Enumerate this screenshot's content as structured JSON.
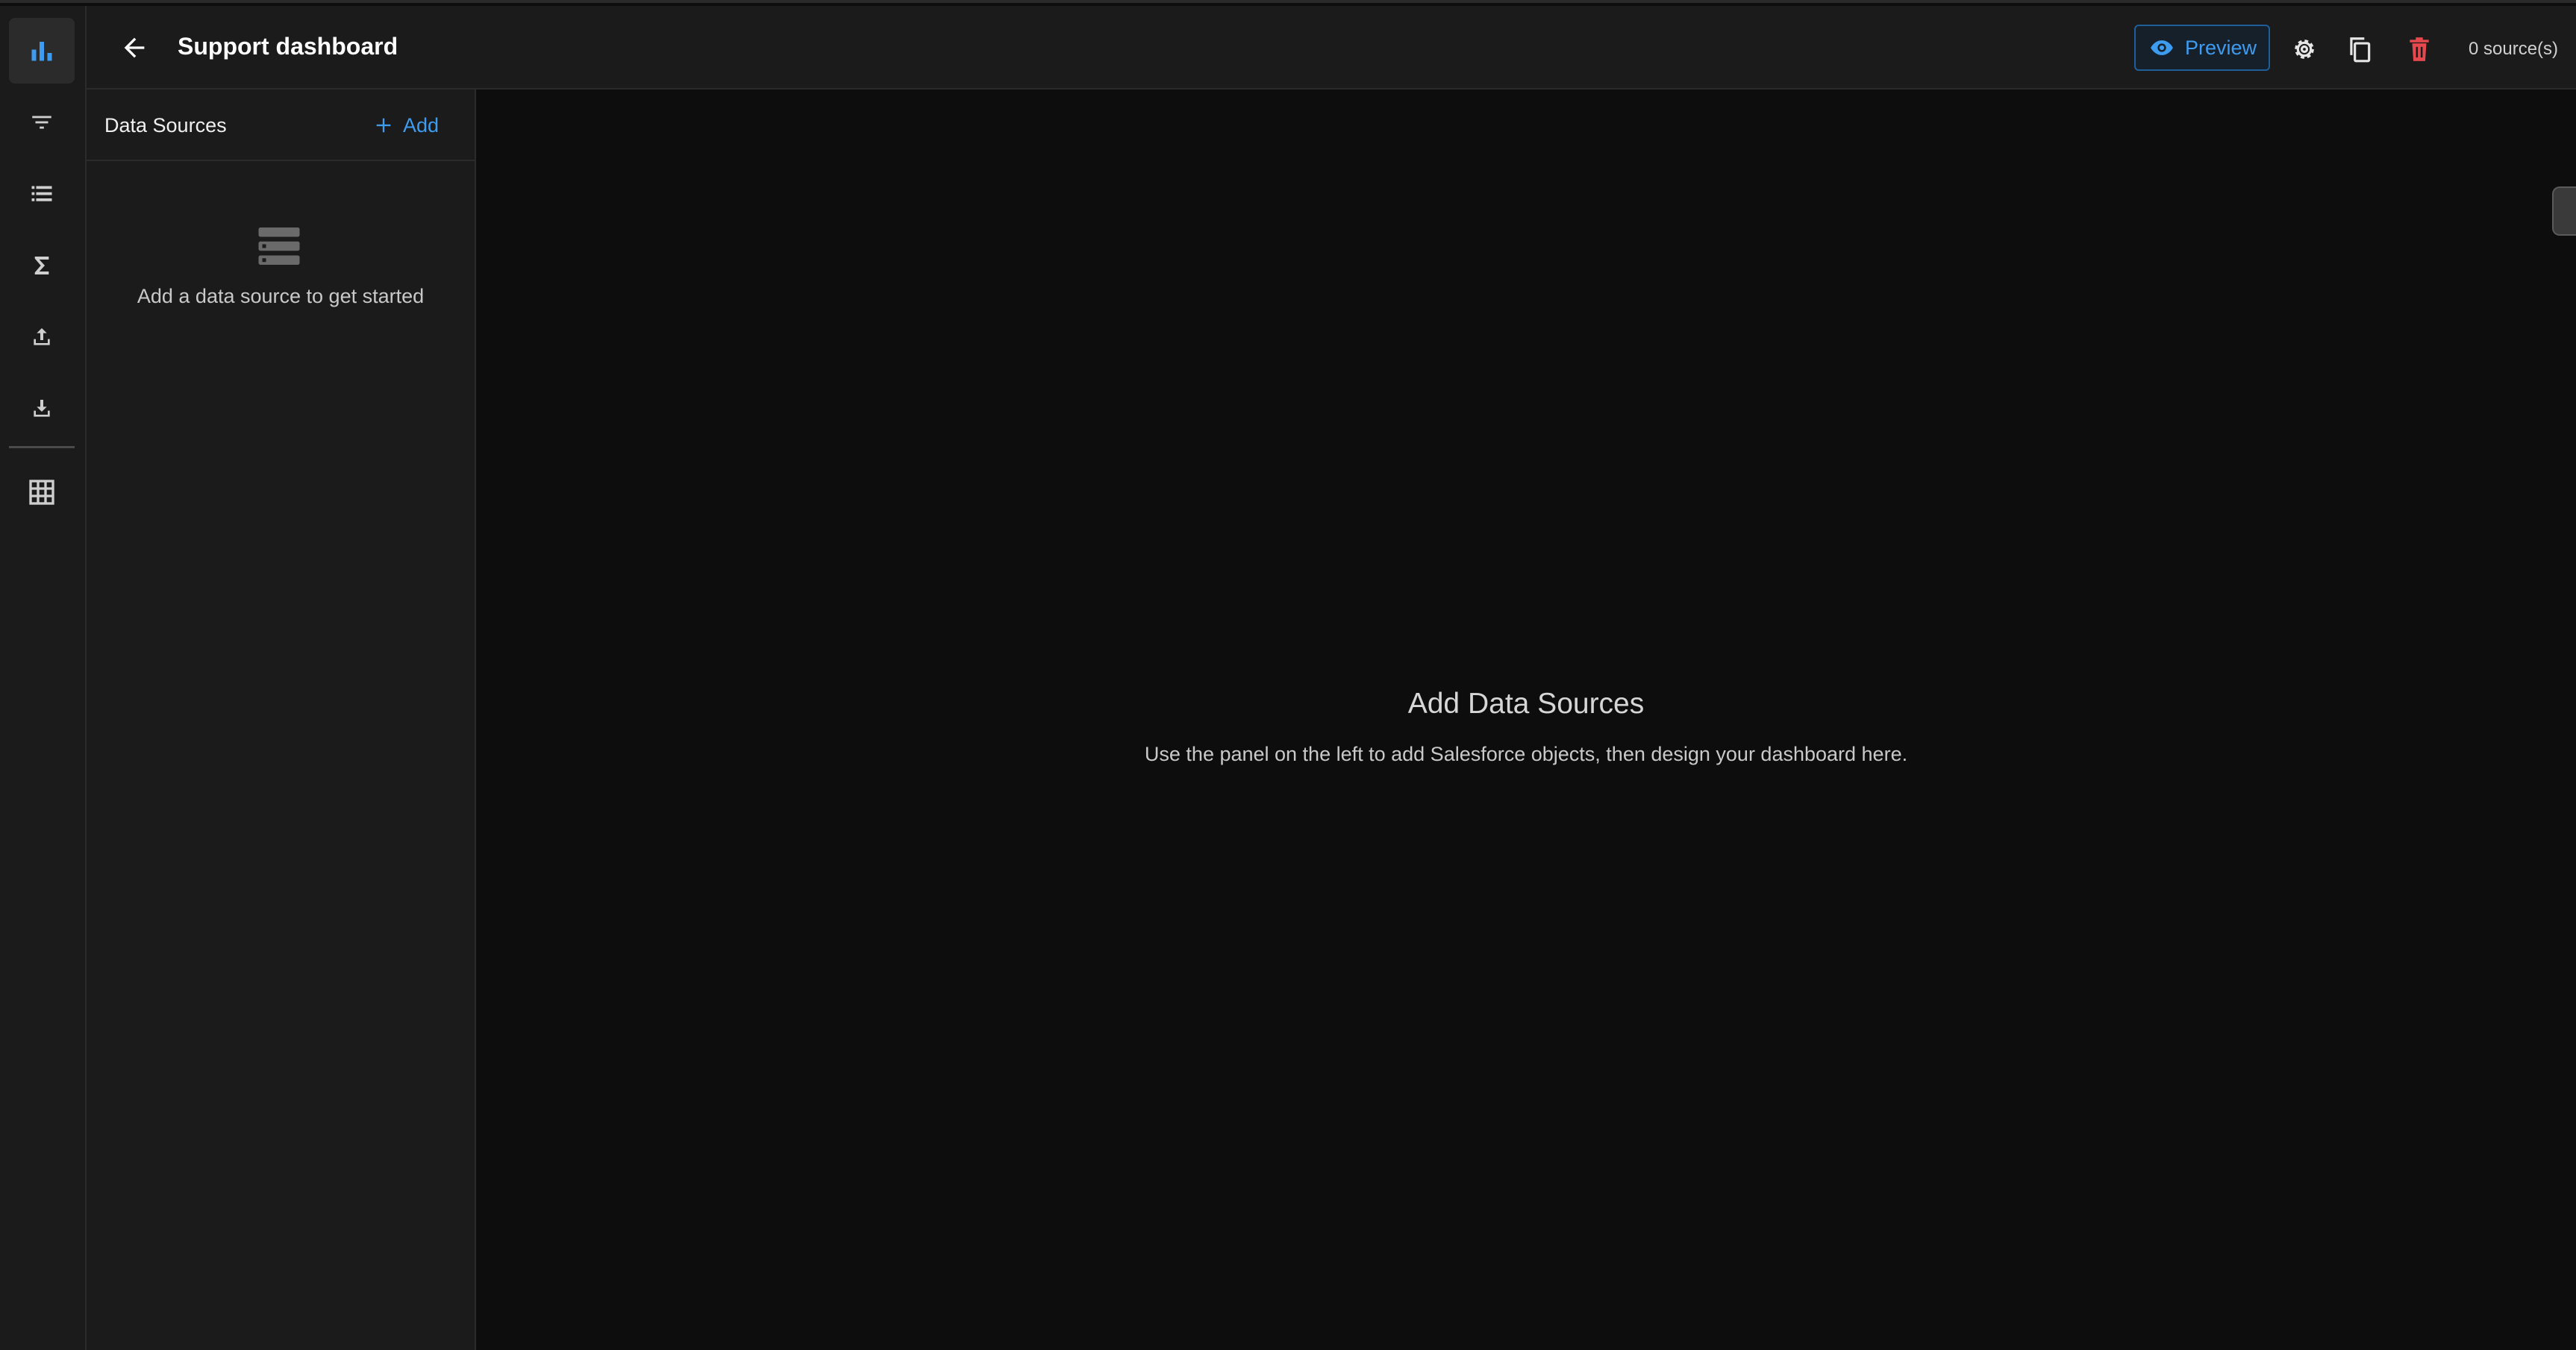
{
  "header": {
    "title": "Support dashboard",
    "preview_label": "Preview",
    "source_count": "0 source(s)"
  },
  "rail": {
    "items": [
      {
        "icon": "bar-chart-icon",
        "active": true
      },
      {
        "icon": "filter-icon",
        "active": false
      },
      {
        "icon": "list-icon",
        "active": false
      },
      {
        "icon": "sigma-icon",
        "active": false
      },
      {
        "icon": "upload-icon",
        "active": false
      },
      {
        "icon": "download-icon",
        "active": false
      },
      {
        "icon": "grid-icon",
        "active": false
      }
    ]
  },
  "panel": {
    "title": "Data Sources",
    "add_label": "Add",
    "empty_text": "Add a data source to get started"
  },
  "canvas": {
    "title": "Add Data Sources",
    "subtitle": "Use the panel on the left to add Salesforce objects, then design your dashboard here."
  },
  "colors": {
    "accent": "#3d9cf0",
    "danger": "#e5484d",
    "background": "#0d0d0d",
    "surface": "#1b1b1b"
  }
}
